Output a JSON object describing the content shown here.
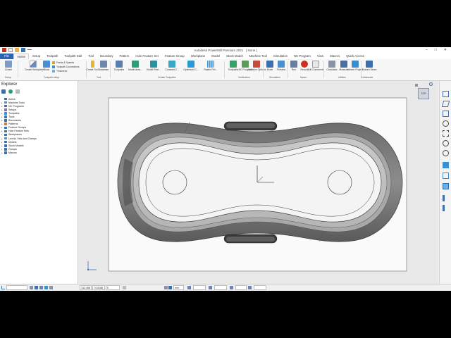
{
  "app": {
    "title": "Autodesk PowerMill Premium 2021",
    "project": "[ None ]"
  },
  "menu": [
    "File",
    "Home",
    "Setup",
    "Toolpath",
    "Toolpath Edit",
    "Tool",
    "Boundary",
    "Pattern",
    "Hole Feature Set",
    "Feature Group",
    "Workplane",
    "Model",
    "Stock Model",
    "Machine Tool",
    "Simulation",
    "NC Program",
    "View",
    "Macros",
    "Quick Access"
  ],
  "ribbon": {
    "create": "Create",
    "workplane": "Create Workplane",
    "block": "Block",
    "feeds": "Feeds & Speeds",
    "connections": "Toolpath Connections",
    "thickness": "Thickness",
    "create_tool": "Create Tool",
    "database": "Database",
    "toolpaths": "Toolpaths",
    "model_area": "Model Area...",
    "model_rest": "Model Rest...",
    "constant_z": "Constant Z...",
    "optimized": "Optimised C...",
    "raster": "Raster Fini...",
    "verif_toolpaths": "Toolpaths",
    "nc_program": "NC Program",
    "collision": "Collision Options",
    "mode": "Mode",
    "preview": "Preview",
    "run": "Run",
    "record": "Record",
    "edit_comments": "Edit Comments",
    "calculator": "Calculator",
    "measure": "Measure",
    "viewer": "Viewer Project",
    "shared_views": "Shared Views",
    "groups": [
      "Setup",
      "Toolpath setup",
      "Tool",
      "Create Toolpaths",
      "Verification",
      "Simulation",
      "Macro",
      "Utilities",
      "Collaborate"
    ]
  },
  "explorer": {
    "title": "Explorer",
    "items": [
      {
        "label": "Active",
        "color": "#3a6fb0"
      },
      {
        "label": "Machine Tools",
        "color": "#6f86a8"
      },
      {
        "label": "NC Programs",
        "color": "#3a6fb0"
      },
      {
        "label": "Setups",
        "color": "#8a6fb0"
      },
      {
        "label": "Toolpaths",
        "color": "#3a8fd0"
      },
      {
        "label": "Tools",
        "color": "#3a6fb0"
      },
      {
        "label": "Boundaries",
        "color": "#3a6fb0"
      },
      {
        "label": "Patterns",
        "color": "#d07a3a"
      },
      {
        "label": "Feature Groups",
        "color": "#3a6fb0"
      },
      {
        "label": "Hole Feature Sets",
        "color": "#3a6fb0"
      },
      {
        "label": "Workplanes",
        "color": "#3a6fb0"
      },
      {
        "label": "Levels, Sets and Clamps",
        "color": "#6f86a8"
      },
      {
        "label": "Models",
        "color": "#3a6fb0"
      },
      {
        "label": "Stock Models",
        "color": "#3a6fb0"
      },
      {
        "label": "Groups",
        "color": "#3a6fb0"
      },
      {
        "label": "Macros",
        "color": "#3a6fb0"
      }
    ]
  },
  "status": {
    "x": "132.468",
    "y": "74.5188",
    "z": "0",
    "units": "mm"
  },
  "viewcube": {
    "label": "TOP"
  },
  "colors": {
    "accent": "#2b64b0",
    "part_edge": "#555555"
  }
}
